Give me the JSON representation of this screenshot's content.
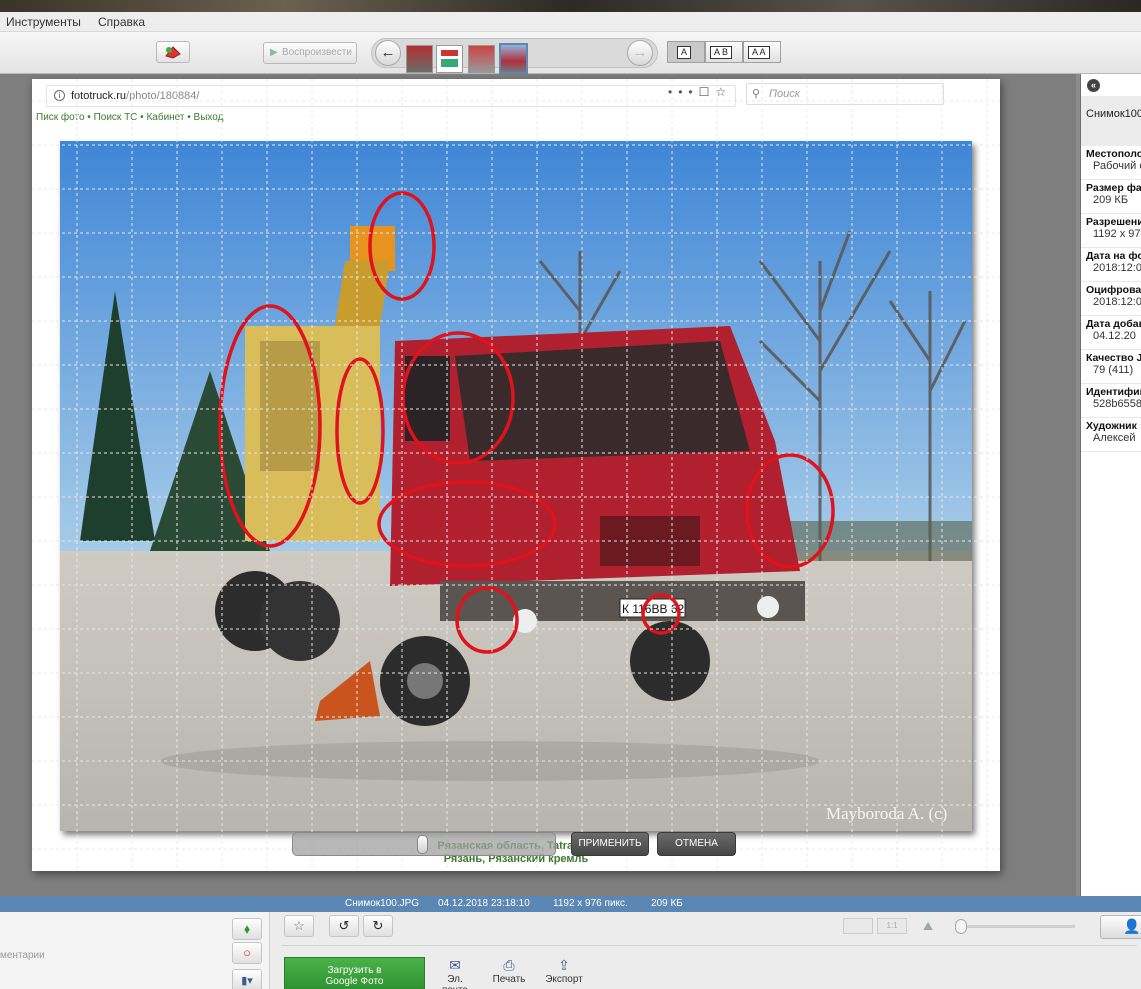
{
  "menu": {
    "items": [
      "Инструменты",
      "Справка"
    ]
  },
  "toolbar": {
    "play_label": "Воспроизвести",
    "back_icon": "arrow-left-icon",
    "forward_icon": "arrow-right-icon",
    "view_modes": [
      "A",
      "A B",
      "A A"
    ]
  },
  "browser": {
    "url_host": "fototruck.ru",
    "url_path": "/photo/180884/",
    "search_placeholder": "Поиск",
    "site_nav": "Писк фото • Поиск ТС • Кабинет • Выход",
    "caption_line1": "Рязанская область, Tatra 815",
    "caption_line2": "Рязань, Рязанский кремль"
  },
  "photo": {
    "watermark": "Mayboroda A. (c)",
    "plate": "К 116ВВ 62"
  },
  "editor": {
    "apply_label": "ПРИМЕНИТЬ",
    "cancel_label": "ОТМЕНА",
    "slider_value": 0.5
  },
  "panel": {
    "title": "Снимок100",
    "fields": [
      {
        "label": "Местополо",
        "value": "Рабочий с"
      },
      {
        "label": "Размер фа",
        "value": "209 КБ"
      },
      {
        "label": "Разрешени",
        "value": "1192 x 97"
      },
      {
        "label": "Дата на фо",
        "value": "2018:12:0"
      },
      {
        "label": "Оцифрова",
        "value": "2018:12:0"
      },
      {
        "label": "Дата добав",
        "value": "04.12.20"
      },
      {
        "label": "Качество J",
        "value": "79 (411)"
      },
      {
        "label": "Идентифик",
        "value": "528b6558"
      },
      {
        "label": "Художник",
        "value": "Алексей"
      }
    ]
  },
  "status": {
    "filename": "Снимок100.JPG",
    "datetime": "04.12.2018 23:18:10",
    "dimensions": "1192 x 976 пикс.",
    "size": "209 КБ"
  },
  "bottom": {
    "left_text": "ментарии",
    "upload_label_line1": "Загрузить в",
    "upload_label_line2": "Google Фото",
    "actions": [
      {
        "icon": "mail-icon",
        "label": "Эл. почта"
      },
      {
        "icon": "print-icon",
        "label": "Печать"
      },
      {
        "icon": "export-icon",
        "label": "Экспорт"
      }
    ]
  },
  "colors": {
    "annotation": "#e0121b",
    "statusbar": "#5a87b3",
    "link_green": "#3d7a2c",
    "truck_red": "#b0202e"
  }
}
